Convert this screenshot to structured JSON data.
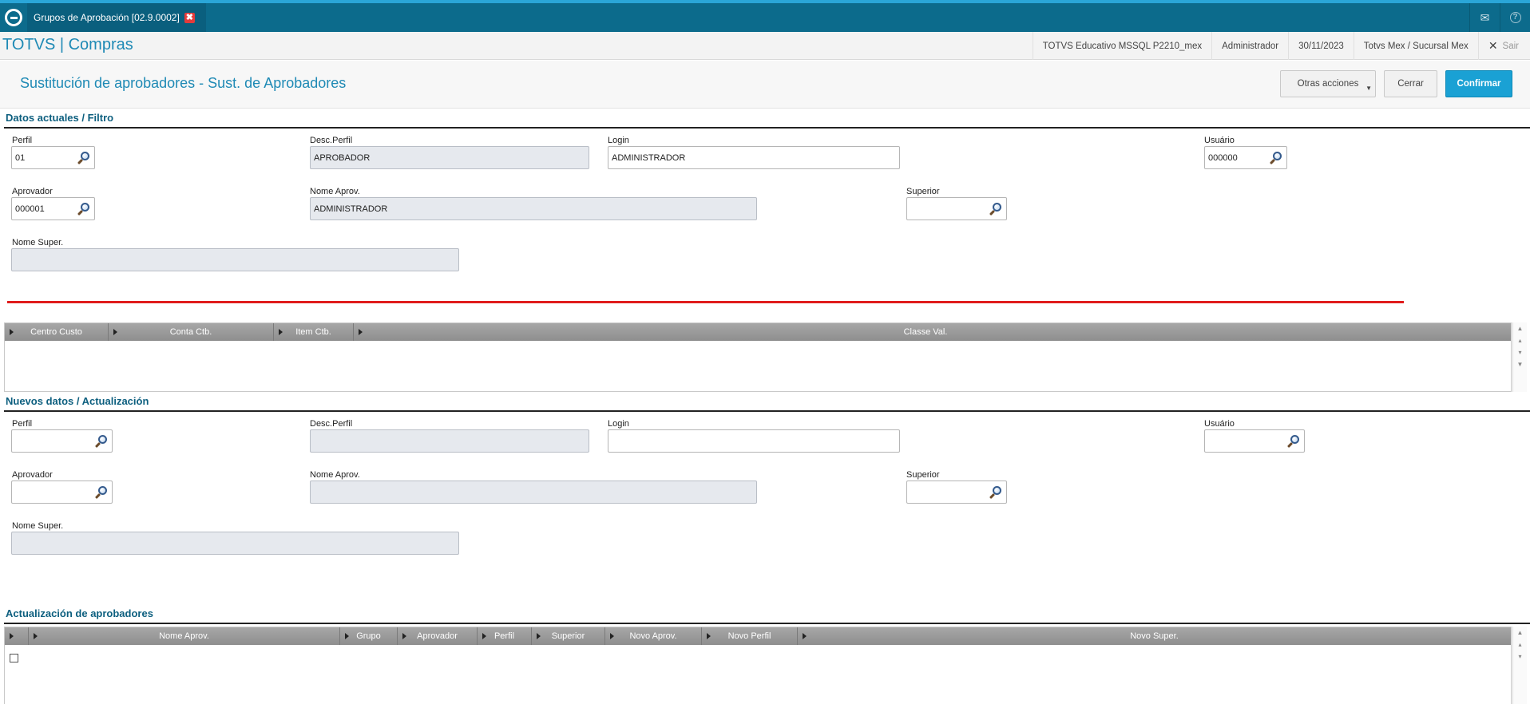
{
  "window": {
    "tab_title": "Grupos de Aprobación [02.9.0002]",
    "close_glyph": "✖"
  },
  "topbar_icons": [
    "mail-icon",
    "help-icon"
  ],
  "app": {
    "title": "TOTVS | Compras",
    "environment": "TOTVS Educativo MSSQL P2210_mex",
    "user": "Administrador",
    "date": "30/11/2023",
    "branch": "Totvs Mex / Sucursal Mex",
    "logout_label": "Sair"
  },
  "page": {
    "title": "Sustitución de aprobadores - Sust. de Aprobadores",
    "buttons": {
      "other_actions": "Otras acciones",
      "close": "Cerrar",
      "confirm": "Confirmar"
    }
  },
  "current": {
    "section_title": "Datos actuales / Filtro",
    "labels": {
      "perfil": "Perfil",
      "desc_perfil": "Desc.Perfil",
      "login": "Login",
      "usuario": "Usuário",
      "aprovador": "Aprovador",
      "nome_aprov": "Nome Aprov.",
      "superior": "Superior",
      "nome_super": "Nome Super."
    },
    "values": {
      "perfil": "01",
      "desc_perfil": "APROBADOR",
      "login": "ADMINISTRADOR",
      "usuario": "000000",
      "aprovador": "000001",
      "nome_aprov": "ADMINISTRADOR",
      "superior": "",
      "nome_super": ""
    }
  },
  "filter_grid": {
    "columns": [
      "Centro Custo",
      "Conta Ctb.",
      "Item Ctb.",
      "Classe Val."
    ]
  },
  "new": {
    "section_title": "Nuevos datos / Actualización",
    "labels": {
      "perfil": "Perfil",
      "desc_perfil": "Desc.Perfil",
      "login": "Login",
      "usuario": "Usuário",
      "aprovador": "Aprovador",
      "nome_aprov": "Nome Aprov.",
      "superior": "Superior",
      "nome_super": "Nome Super."
    },
    "values": {
      "perfil": "",
      "desc_perfil": "",
      "login": "",
      "usuario": "",
      "aprovador": "",
      "nome_aprov": "",
      "superior": "",
      "nome_super": ""
    }
  },
  "update": {
    "section_title": "Actualización de aprobadores",
    "columns": [
      "",
      "Nome Aprov.",
      "Grupo",
      "Aprovador",
      "Perfil",
      "Superior",
      "Novo Aprov.",
      "Novo Perfil",
      "Novo Super."
    ]
  },
  "colors": {
    "topbar": "#0c6b8c",
    "accent": "#1f8ab5",
    "confirm": "#1aa1d4",
    "red_line": "#e01c1c",
    "section_title": "#0d5f7f"
  }
}
